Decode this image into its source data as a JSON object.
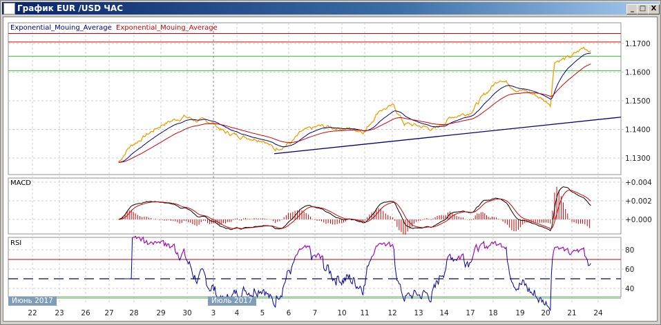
{
  "window": {
    "title": "График EUR /USD  ЧАС",
    "buttons": {
      "minimize": "_",
      "maximize": "□",
      "close": "X"
    }
  },
  "legend": {
    "ema_fast": "Exponential_Mouing_Average",
    "ema_slow": "Exponential_Mouing_Average"
  },
  "panes": {
    "macd_label": "MACD",
    "rsi_label": "RSI"
  },
  "months": [
    "Июнь 2017",
    "Июль 2017"
  ],
  "colors": {
    "price": "#f0a000",
    "ema_fast": "#000080",
    "ema_slow": "#d00000",
    "macd_hist": "#d00000",
    "rsi": "#0000a0",
    "rsi_overbought": "#c000c0",
    "green": "#30c030"
  },
  "chart_data": {
    "type": "line",
    "x_ticks": [
      "22",
      "23",
      "26",
      "27",
      "28",
      "29",
      "30",
      "3",
      "4",
      "5",
      "6",
      "7",
      "10",
      "11",
      "12",
      "13",
      "14",
      "17",
      "18",
      "19",
      "20",
      "21",
      "24"
    ],
    "price_axis": {
      "ticks": [
        "1.1700",
        "1.1600",
        "1.1500",
        "1.1400",
        "1.1300"
      ],
      "values": [
        1.17,
        1.16,
        1.15,
        1.14,
        1.13
      ]
    },
    "macd_axis": {
      "ticks": [
        "+0.004",
        "+0.002",
        "+0.000"
      ],
      "values": [
        0.004,
        0.002,
        0
      ]
    },
    "rsi_axis": {
      "ticks": [
        "80",
        "60",
        "40"
      ],
      "values": [
        80,
        60,
        40
      ]
    },
    "levels": {
      "red": [
        1.1735,
        1.1705
      ],
      "green": [
        1.1655,
        1.1605
      ]
    },
    "rsi_levels": {
      "upper": 70,
      "mid": 50,
      "lower": 30
    },
    "trendline": [
      [
        9.45,
        1.1315
      ],
      [
        22.6,
        1.144
      ]
    ],
    "price_keypoints": [
      [
        3.38,
        1.1285
      ],
      [
        3.77,
        1.1335
      ],
      [
        4.3,
        1.137
      ],
      [
        5.09,
        1.142
      ],
      [
        5.88,
        1.1445
      ],
      [
        6.41,
        1.143
      ],
      [
        6.94,
        1.1425
      ],
      [
        7.47,
        1.139
      ],
      [
        8.26,
        1.1375
      ],
      [
        9.05,
        1.1365
      ],
      [
        9.45,
        1.133
      ],
      [
        10.11,
        1.1355
      ],
      [
        10.5,
        1.139
      ],
      [
        11.16,
        1.141
      ],
      [
        11.95,
        1.1405
      ],
      [
        13.01,
        1.1395
      ],
      [
        13.54,
        1.147
      ],
      [
        14.06,
        1.148
      ],
      [
        14.46,
        1.142
      ],
      [
        15.12,
        1.141
      ],
      [
        15.65,
        1.14
      ],
      [
        16.31,
        1.1445
      ],
      [
        16.97,
        1.146
      ],
      [
        17.63,
        1.152
      ],
      [
        18.28,
        1.158
      ],
      [
        18.81,
        1.1545
      ],
      [
        19.6,
        1.152
      ],
      [
        20.18,
        1.149
      ],
      [
        20.34,
        1.164
      ],
      [
        20.92,
        1.165
      ],
      [
        21.45,
        1.1685
      ],
      [
        21.72,
        1.1675
      ]
    ]
  }
}
